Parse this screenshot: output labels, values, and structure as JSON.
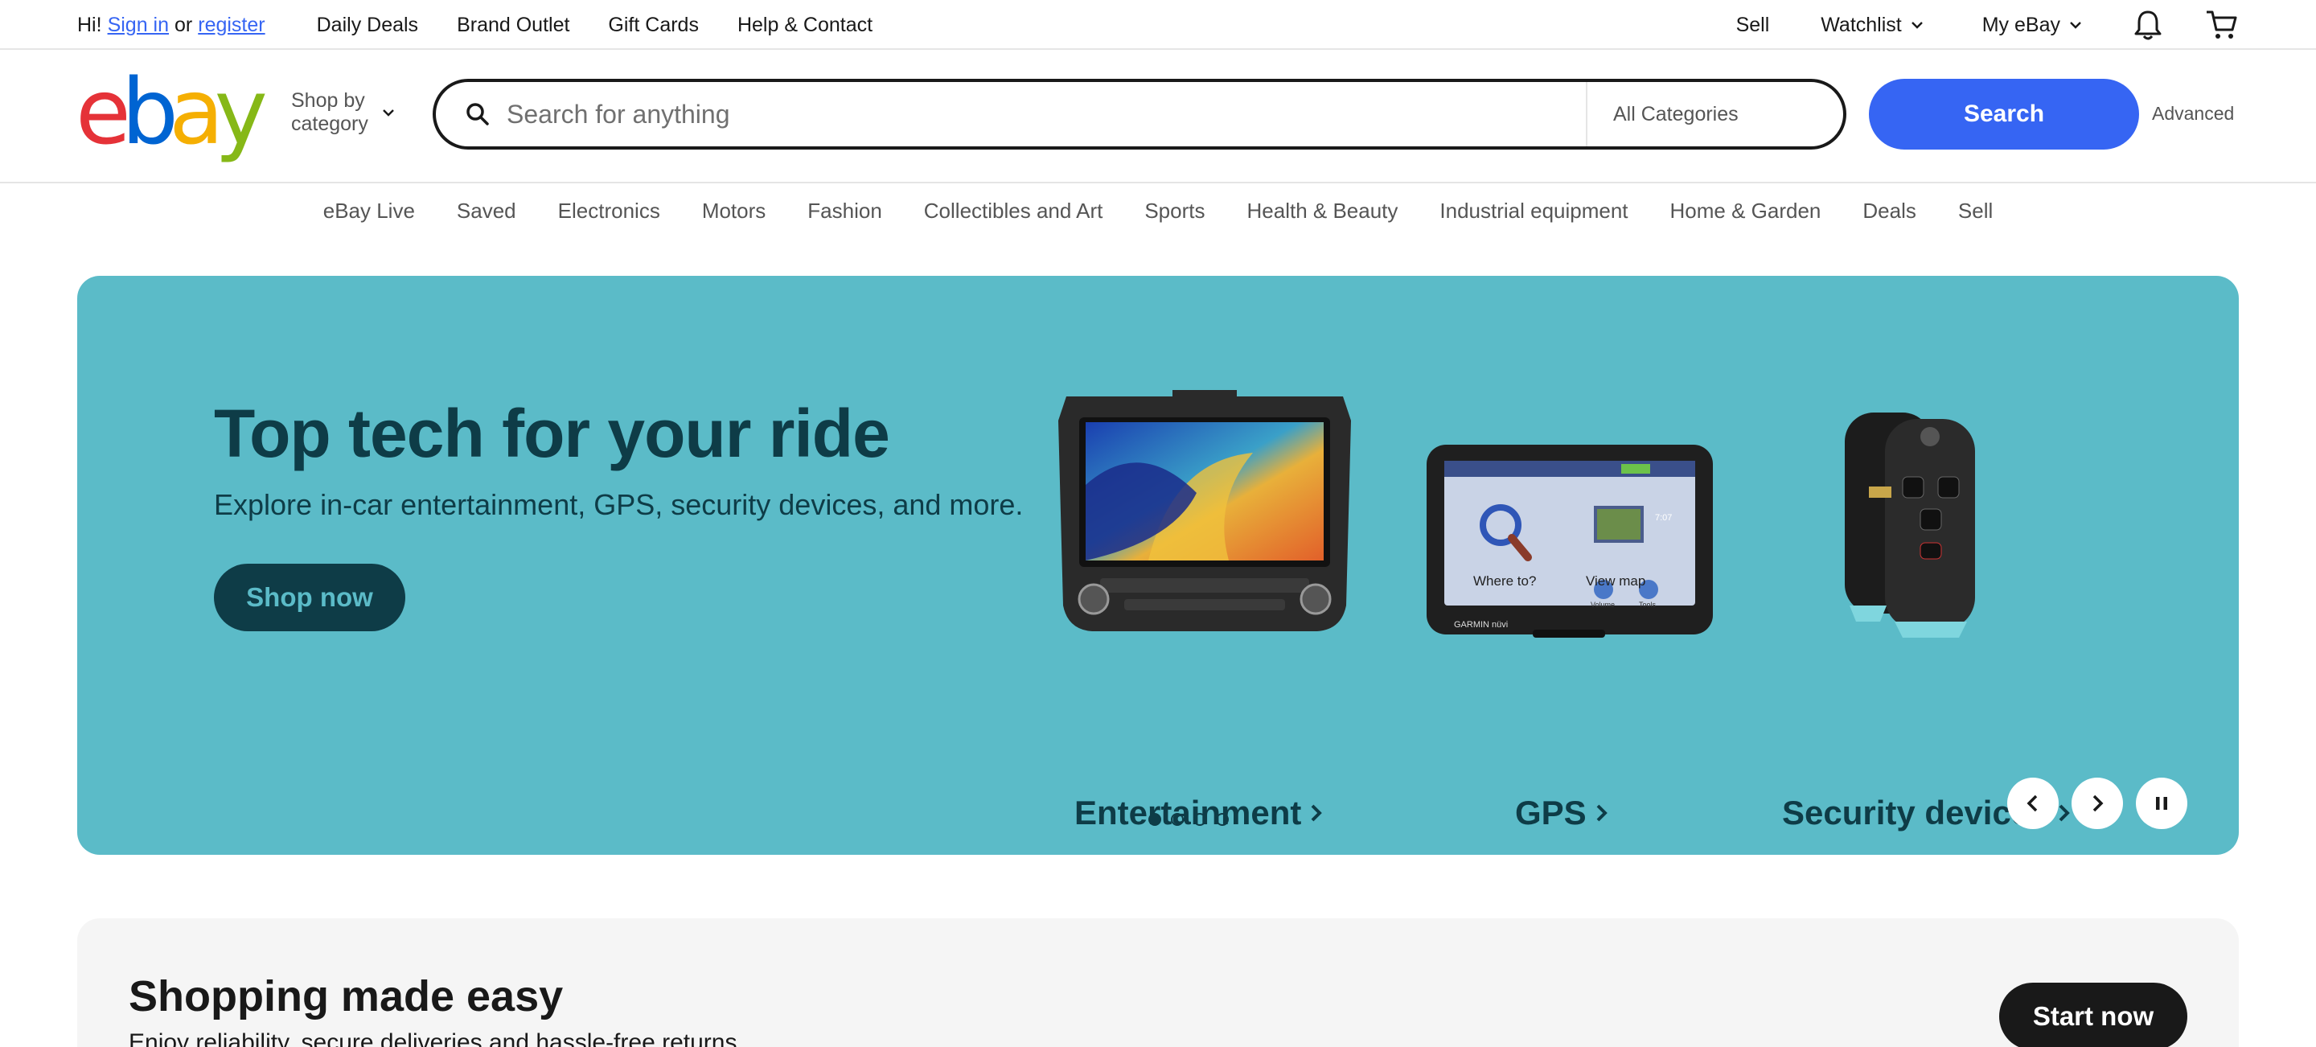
{
  "topbar": {
    "greeting_prefix": "Hi!",
    "sign_in": "Sign in",
    "or": "or",
    "register": "register",
    "links": [
      "Daily Deals",
      "Brand Outlet",
      "Gift Cards",
      "Help & Contact"
    ],
    "sell": "Sell",
    "watchlist": "Watchlist",
    "my_ebay": "My eBay"
  },
  "header": {
    "logo": {
      "e": "e",
      "b": "b",
      "a": "a",
      "y": "y"
    },
    "shop_by_line1": "Shop by",
    "shop_by_line2": "category",
    "search_placeholder": "Search for anything",
    "category_select": "All Categories",
    "search_button": "Search",
    "advanced": "Advanced"
  },
  "nav": {
    "items": [
      "eBay Live",
      "Saved",
      "Electronics",
      "Motors",
      "Fashion",
      "Collectibles and Art",
      "Sports",
      "Health & Beauty",
      "Industrial equipment",
      "Home & Garden",
      "Deals",
      "Sell"
    ]
  },
  "hero": {
    "title": "Top tech for your ride",
    "subtitle": "Explore in-car entertainment, GPS, security devices, and more.",
    "cta": "Shop now",
    "tiles": [
      "Entertainment",
      "GPS",
      "Security devices"
    ],
    "gps_screen": {
      "left": "Where to?",
      "right": "View map",
      "time": "7:07",
      "brand": "GARMIN nüvi",
      "btn1": "Volume",
      "btn2": "Tools"
    },
    "slide_count": 4,
    "active_slide": 1
  },
  "promo": {
    "heading": "Shopping made easy",
    "text": "Enjoy reliability, secure deliveries and hassle-free returns.",
    "cta": "Start now"
  },
  "colors": {
    "hero_bg": "#5bbbc8",
    "hero_text": "#0e3c47",
    "search_blue": "#3665f3",
    "link_blue": "#3665f3"
  }
}
